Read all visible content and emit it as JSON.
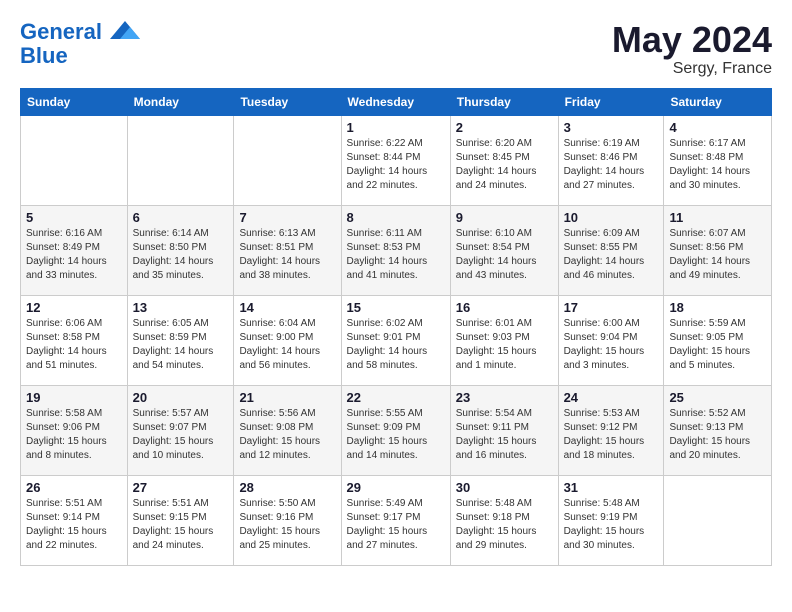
{
  "header": {
    "logo_line1": "General",
    "logo_line2": "Blue",
    "month_title": "May 2024",
    "location": "Sergy, France"
  },
  "weekdays": [
    "Sunday",
    "Monday",
    "Tuesday",
    "Wednesday",
    "Thursday",
    "Friday",
    "Saturday"
  ],
  "weeks": [
    [
      null,
      null,
      null,
      {
        "day": "1",
        "sunrise": "6:22 AM",
        "sunset": "8:44 PM",
        "daylight": "14 hours and 22 minutes."
      },
      {
        "day": "2",
        "sunrise": "6:20 AM",
        "sunset": "8:45 PM",
        "daylight": "14 hours and 24 minutes."
      },
      {
        "day": "3",
        "sunrise": "6:19 AM",
        "sunset": "8:46 PM",
        "daylight": "14 hours and 27 minutes."
      },
      {
        "day": "4",
        "sunrise": "6:17 AM",
        "sunset": "8:48 PM",
        "daylight": "14 hours and 30 minutes."
      }
    ],
    [
      {
        "day": "5",
        "sunrise": "6:16 AM",
        "sunset": "8:49 PM",
        "daylight": "14 hours and 33 minutes."
      },
      {
        "day": "6",
        "sunrise": "6:14 AM",
        "sunset": "8:50 PM",
        "daylight": "14 hours and 35 minutes."
      },
      {
        "day": "7",
        "sunrise": "6:13 AM",
        "sunset": "8:51 PM",
        "daylight": "14 hours and 38 minutes."
      },
      {
        "day": "8",
        "sunrise": "6:11 AM",
        "sunset": "8:53 PM",
        "daylight": "14 hours and 41 minutes."
      },
      {
        "day": "9",
        "sunrise": "6:10 AM",
        "sunset": "8:54 PM",
        "daylight": "14 hours and 43 minutes."
      },
      {
        "day": "10",
        "sunrise": "6:09 AM",
        "sunset": "8:55 PM",
        "daylight": "14 hours and 46 minutes."
      },
      {
        "day": "11",
        "sunrise": "6:07 AM",
        "sunset": "8:56 PM",
        "daylight": "14 hours and 49 minutes."
      }
    ],
    [
      {
        "day": "12",
        "sunrise": "6:06 AM",
        "sunset": "8:58 PM",
        "daylight": "14 hours and 51 minutes."
      },
      {
        "day": "13",
        "sunrise": "6:05 AM",
        "sunset": "8:59 PM",
        "daylight": "14 hours and 54 minutes."
      },
      {
        "day": "14",
        "sunrise": "6:04 AM",
        "sunset": "9:00 PM",
        "daylight": "14 hours and 56 minutes."
      },
      {
        "day": "15",
        "sunrise": "6:02 AM",
        "sunset": "9:01 PM",
        "daylight": "14 hours and 58 minutes."
      },
      {
        "day": "16",
        "sunrise": "6:01 AM",
        "sunset": "9:03 PM",
        "daylight": "15 hours and 1 minute."
      },
      {
        "day": "17",
        "sunrise": "6:00 AM",
        "sunset": "9:04 PM",
        "daylight": "15 hours and 3 minutes."
      },
      {
        "day": "18",
        "sunrise": "5:59 AM",
        "sunset": "9:05 PM",
        "daylight": "15 hours and 5 minutes."
      }
    ],
    [
      {
        "day": "19",
        "sunrise": "5:58 AM",
        "sunset": "9:06 PM",
        "daylight": "15 hours and 8 minutes."
      },
      {
        "day": "20",
        "sunrise": "5:57 AM",
        "sunset": "9:07 PM",
        "daylight": "15 hours and 10 minutes."
      },
      {
        "day": "21",
        "sunrise": "5:56 AM",
        "sunset": "9:08 PM",
        "daylight": "15 hours and 12 minutes."
      },
      {
        "day": "22",
        "sunrise": "5:55 AM",
        "sunset": "9:09 PM",
        "daylight": "15 hours and 14 minutes."
      },
      {
        "day": "23",
        "sunrise": "5:54 AM",
        "sunset": "9:11 PM",
        "daylight": "15 hours and 16 minutes."
      },
      {
        "day": "24",
        "sunrise": "5:53 AM",
        "sunset": "9:12 PM",
        "daylight": "15 hours and 18 minutes."
      },
      {
        "day": "25",
        "sunrise": "5:52 AM",
        "sunset": "9:13 PM",
        "daylight": "15 hours and 20 minutes."
      }
    ],
    [
      {
        "day": "26",
        "sunrise": "5:51 AM",
        "sunset": "9:14 PM",
        "daylight": "15 hours and 22 minutes."
      },
      {
        "day": "27",
        "sunrise": "5:51 AM",
        "sunset": "9:15 PM",
        "daylight": "15 hours and 24 minutes."
      },
      {
        "day": "28",
        "sunrise": "5:50 AM",
        "sunset": "9:16 PM",
        "daylight": "15 hours and 25 minutes."
      },
      {
        "day": "29",
        "sunrise": "5:49 AM",
        "sunset": "9:17 PM",
        "daylight": "15 hours and 27 minutes."
      },
      {
        "day": "30",
        "sunrise": "5:48 AM",
        "sunset": "9:18 PM",
        "daylight": "15 hours and 29 minutes."
      },
      {
        "day": "31",
        "sunrise": "5:48 AM",
        "sunset": "9:19 PM",
        "daylight": "15 hours and 30 minutes."
      },
      null
    ]
  ]
}
